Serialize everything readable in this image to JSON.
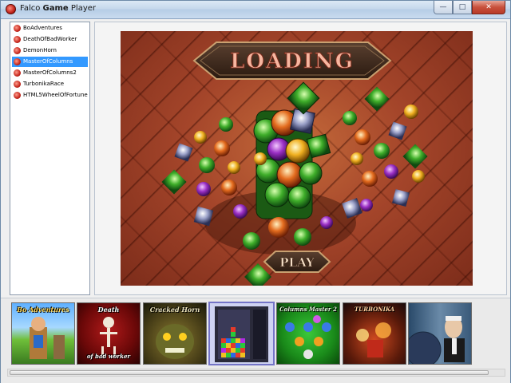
{
  "window": {
    "title_prefix": "Falco ",
    "title_bold": "Game",
    "title_suffix": " Player",
    "controls": [
      "minimize",
      "maximize",
      "close"
    ]
  },
  "sidebar": {
    "items": [
      {
        "label": "BoAdventures",
        "selected": false
      },
      {
        "label": "DeathOfBadWorker",
        "selected": false
      },
      {
        "label": "DemonHorn",
        "selected": false
      },
      {
        "label": "MasterOfColumns",
        "selected": true
      },
      {
        "label": "MasterOfColumns2",
        "selected": false
      },
      {
        "label": "TurbonikaRace",
        "selected": false
      },
      {
        "label": "HTML5WheelOfFortune",
        "selected": false
      }
    ]
  },
  "game": {
    "loading_text": "LOADING",
    "play_text": "PLAY"
  },
  "thumbnails": [
    {
      "label": "Bo Adventures",
      "selected": false
    },
    {
      "label_top": "Death",
      "label_bottom": "of bad worker",
      "selected": false
    },
    {
      "label": "Cracked Horn",
      "selected": false
    },
    {
      "label": "",
      "selected": true
    },
    {
      "label": "Columns Master 2",
      "selected": false
    },
    {
      "label": "TURBONIKA",
      "selected": false
    },
    {
      "label": "",
      "selected": false
    }
  ],
  "colors": {
    "selection": "#3399ff",
    "thumb_selected_border": "#7474c8",
    "title_gradient_top": "#dbe8f5",
    "close_red": "#c8503c"
  }
}
